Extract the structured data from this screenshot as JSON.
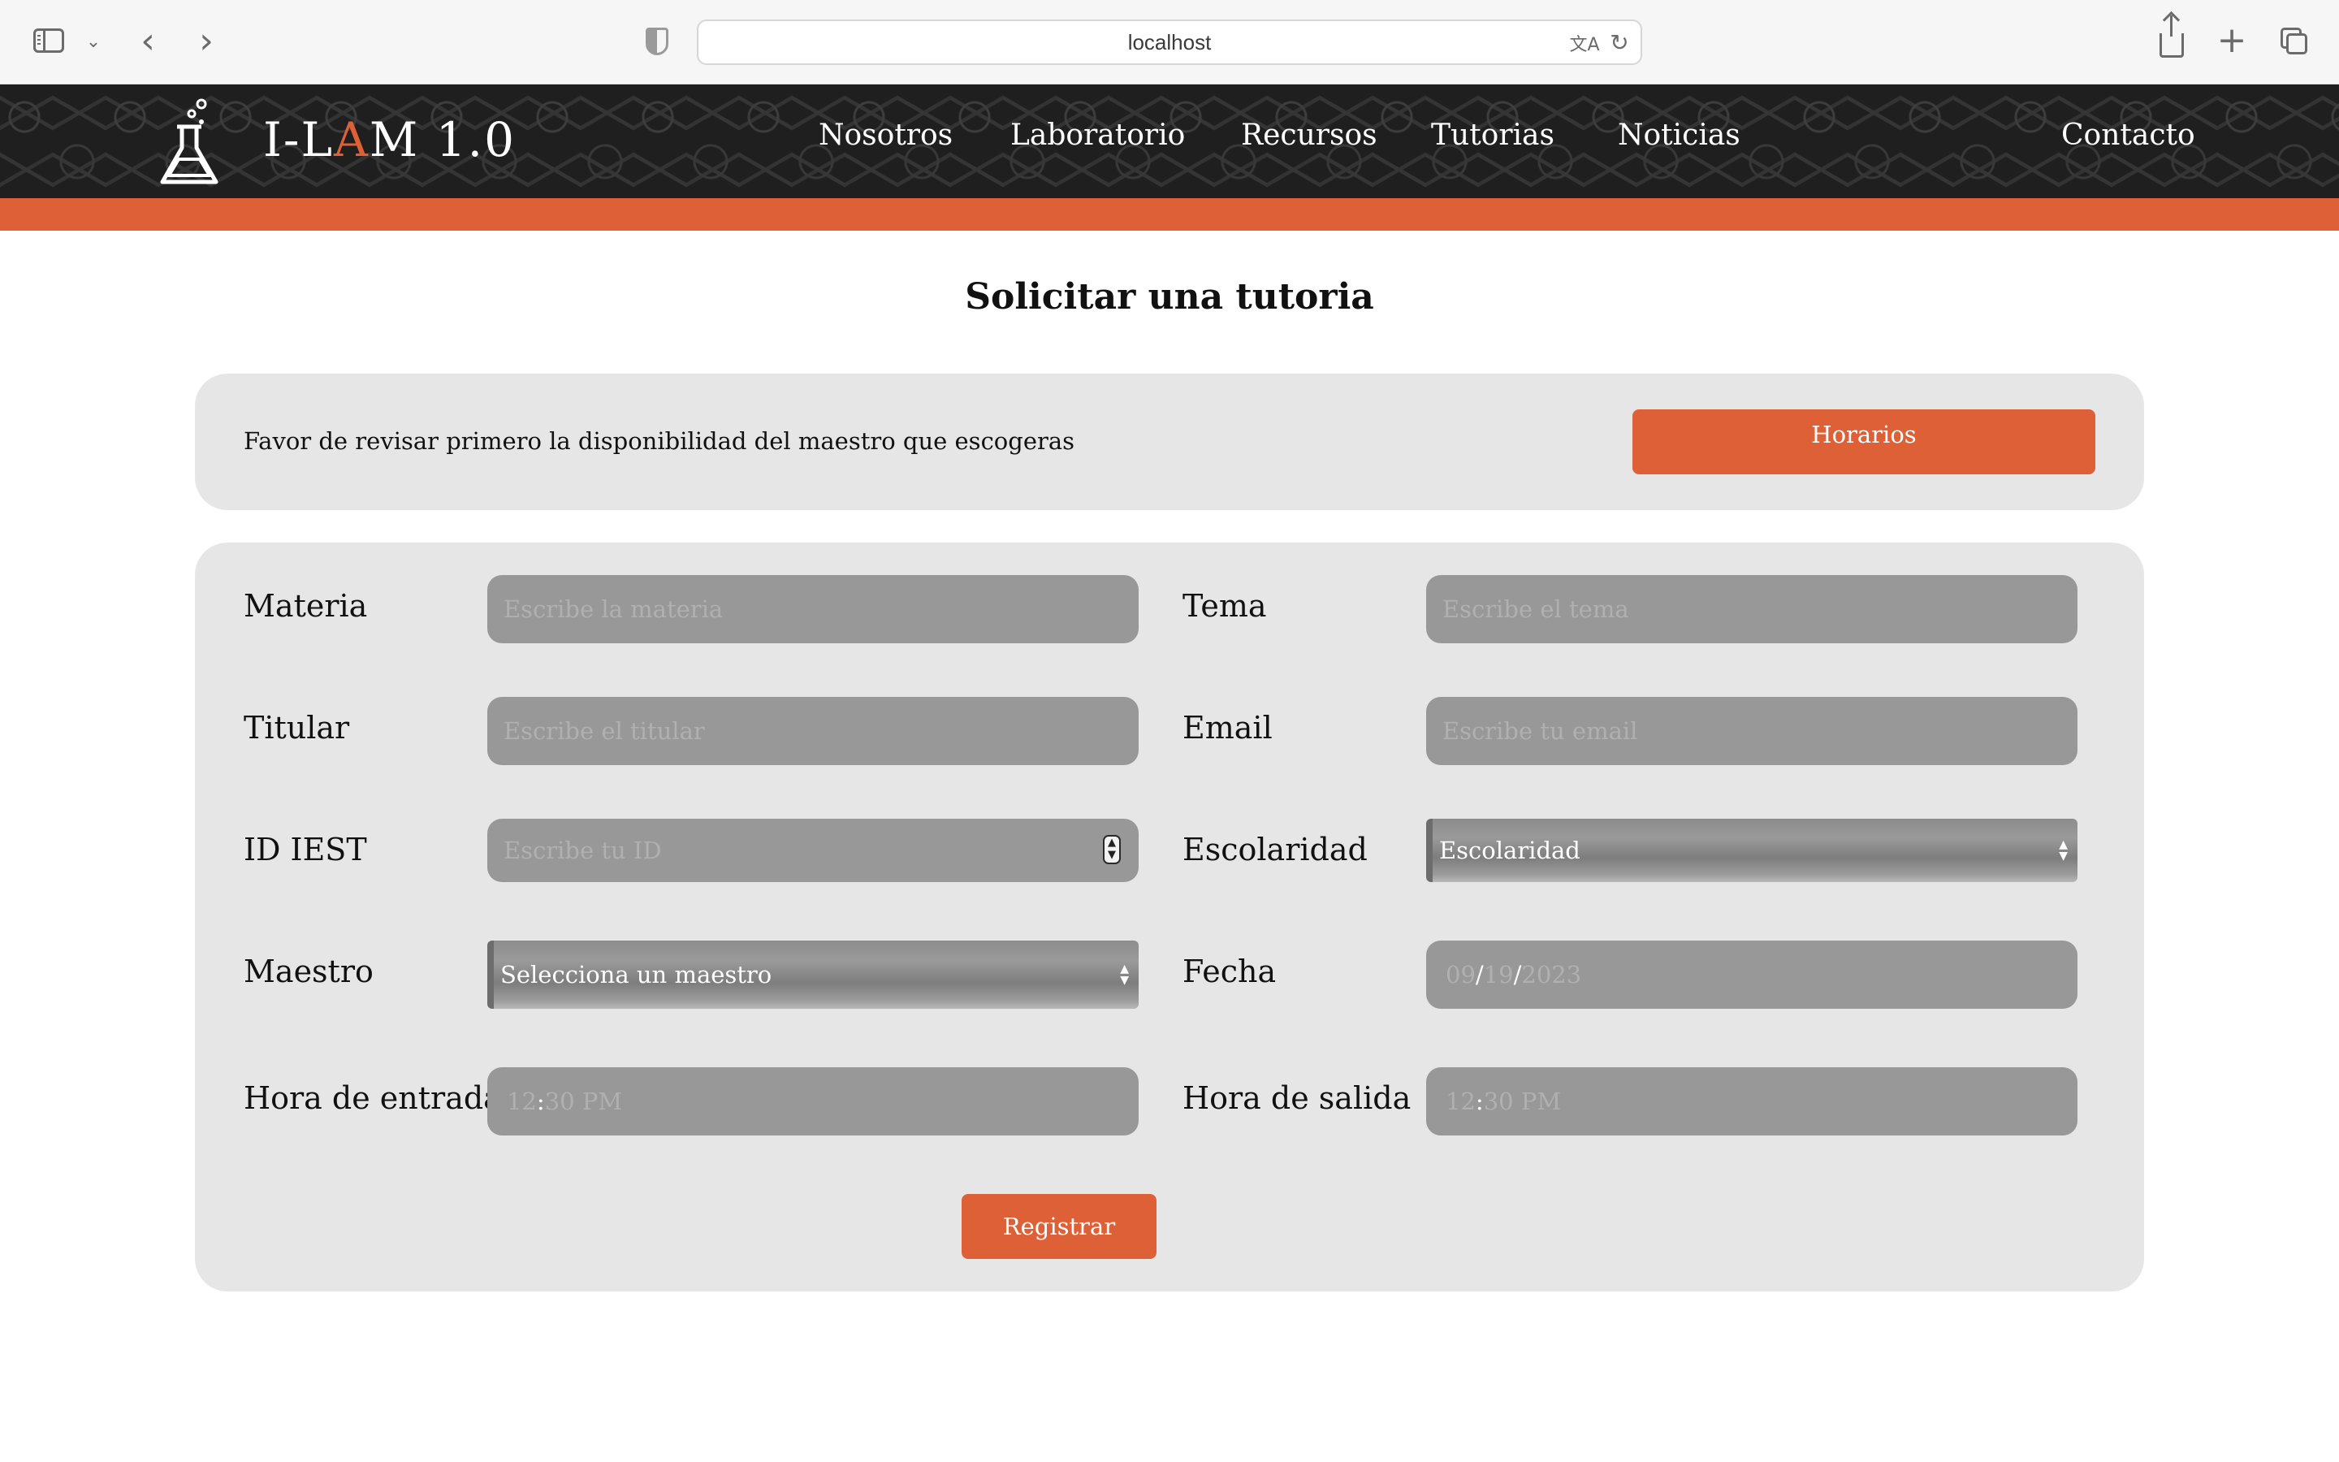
{
  "browser": {
    "url": "localhost",
    "icons": {
      "sidebar": "sidebar-icon",
      "chevron": "chevron-down-icon",
      "back": "back-arrow-icon",
      "forward": "forward-arrow-icon",
      "privacy": "shield-icon",
      "translate": "translate-icon",
      "reload": "reload-icon",
      "share": "share-icon",
      "new_tab": "plus-icon",
      "tab_overview": "tabs-icon"
    }
  },
  "site": {
    "logo_icon": "flask-icon",
    "logo_prefix": "I-L",
    "logo_accent": "A",
    "logo_suffix": "M 1.0",
    "nav": [
      "Nosotros",
      "Laboratorio",
      "Recursos",
      "Tutorias",
      "Noticias",
      "Contacto"
    ],
    "colors": {
      "accent": "#de6036",
      "header_bg": "#1f1f1f",
      "card_bg": "#e6e6e6",
      "field_bg": "#989898"
    }
  },
  "page": {
    "title": "Solicitar una tutoria",
    "notice": {
      "text": "Favor de revisar primero la disponibilidad del maestro que escogeras",
      "button": "Horarios"
    },
    "form": {
      "materia": {
        "label": "Materia",
        "placeholder": "Escribe la materia"
      },
      "tema": {
        "label": "Tema",
        "placeholder": "Escribe el tema"
      },
      "titular": {
        "label": "Titular",
        "placeholder": "Escribe el titular"
      },
      "email": {
        "label": "Email",
        "placeholder": "Escribe tu email"
      },
      "id_iest": {
        "label": "ID IEST",
        "placeholder": "Escribe tu ID"
      },
      "escolaridad": {
        "label": "Escolaridad",
        "selected": "Escolaridad"
      },
      "maestro": {
        "label": "Maestro",
        "selected": "Selecciona un maestro"
      },
      "fecha": {
        "label": "Fecha",
        "month": "09",
        "day": "19",
        "year": "2023",
        "separator": "/"
      },
      "hora_entrada": {
        "label": "Hora de entrada",
        "hour": "12",
        "minute": "30",
        "period": "PM",
        "separator": ":"
      },
      "hora_salida": {
        "label": "Hora de salida",
        "hour": "12",
        "minute": "30",
        "period": "PM",
        "separator": ":"
      },
      "submit": "Registrar"
    }
  }
}
